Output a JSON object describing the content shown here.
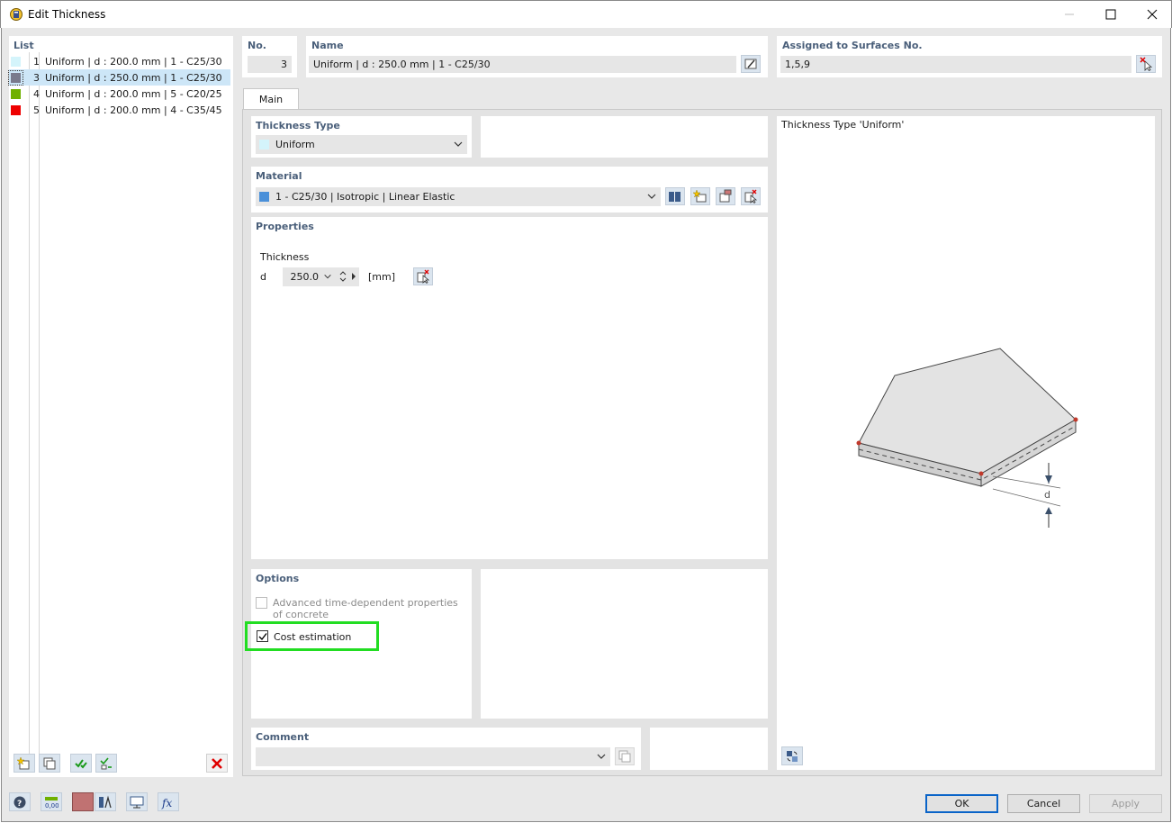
{
  "window": {
    "title": "Edit Thickness"
  },
  "list": {
    "title": "List",
    "items": [
      {
        "num": "1",
        "label": "Uniform | d : 200.0 mm | 1 - C25/30",
        "color": "#d4f4fb"
      },
      {
        "num": "3",
        "label": "Uniform | d : 250.0 mm | 1 - C25/30",
        "color": "#7a7a8c"
      },
      {
        "num": "4",
        "label": "Uniform | d : 200.0 mm | 5 - C20/25",
        "color": "#6fb000"
      },
      {
        "num": "5",
        "label": "Uniform | d : 200.0 mm | 4 - C35/45",
        "color": "#ee0000"
      }
    ]
  },
  "header": {
    "no_label": "No.",
    "no_value": "3",
    "name_label": "Name",
    "name_value": "Uniform | d : 250.0 mm | 1 - C25/30",
    "assigned_label": "Assigned to Surfaces No.",
    "assigned_value": "1,5,9"
  },
  "tabs": [
    {
      "label": "Main"
    }
  ],
  "thickness_type": {
    "title": "Thickness Type",
    "value": "Uniform",
    "color": "#d4f4fb"
  },
  "material": {
    "title": "Material",
    "value": "1 - C25/30 | Isotropic | Linear Elastic",
    "color": "#4a90d9"
  },
  "properties": {
    "title": "Properties",
    "group": "Thickness",
    "symbol": "d",
    "value": "250.0",
    "unit": "[mm]"
  },
  "options": {
    "title": "Options",
    "advanced_line1": "Advanced time-dependent properties",
    "advanced_line2": "of concrete",
    "advanced_checked": false,
    "cost_label": "Cost estimation",
    "cost_checked": true
  },
  "comment": {
    "title": "Comment",
    "value": ""
  },
  "preview": {
    "title": "Thickness Type  'Uniform'",
    "dim_label": "d"
  },
  "footer": {
    "ok": "OK",
    "cancel": "Cancel",
    "apply": "Apply"
  },
  "icons": {
    "app": "edit-thickness-icon",
    "minimize": "minimize-icon",
    "maximize": "maximize-icon",
    "close": "close-icon"
  }
}
